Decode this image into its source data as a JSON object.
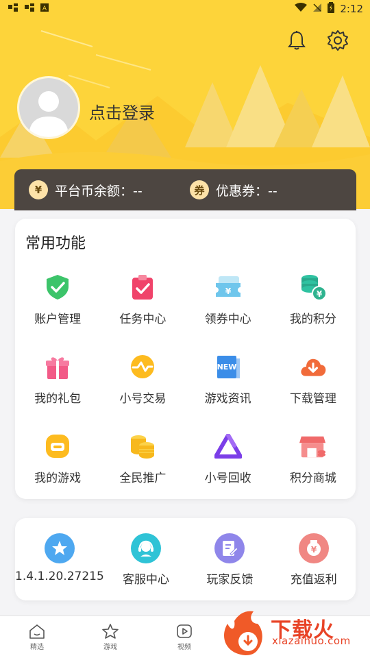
{
  "status_bar": {
    "time": "2:12"
  },
  "profile": {
    "login_text": "点击登录"
  },
  "balance": {
    "coin_icon": "¥",
    "coin_label": "平台币余额：--",
    "coupon_icon": "券",
    "coupon_label": "优惠券：--"
  },
  "common": {
    "title": "常用功能",
    "items": [
      {
        "label": "账户管理",
        "icon": "shield-check-icon"
      },
      {
        "label": "任务中心",
        "icon": "clipboard-check-icon"
      },
      {
        "label": "领券中心",
        "icon": "coupon-ticket-icon"
      },
      {
        "label": "我的积分",
        "icon": "coin-stack-icon"
      },
      {
        "label": "我的礼包",
        "icon": "gift-icon"
      },
      {
        "label": "小号交易",
        "icon": "trade-wave-icon"
      },
      {
        "label": "游戏资讯",
        "icon": "news-icon"
      },
      {
        "label": "下载管理",
        "icon": "cloud-download-icon"
      },
      {
        "label": "我的游戏",
        "icon": "gamepad-icon"
      },
      {
        "label": "全民推广",
        "icon": "coins-icon"
      },
      {
        "label": "小号回收",
        "icon": "recycle-icon"
      },
      {
        "label": "积分商城",
        "icon": "shop-icon"
      }
    ]
  },
  "secondary": {
    "items": [
      {
        "label": "1.4.1.20.27215",
        "icon": "star-icon",
        "color": "#4ea8f0"
      },
      {
        "label": "客服中心",
        "icon": "headset-icon",
        "color": "#2fc3d6"
      },
      {
        "label": "玩家反馈",
        "icon": "feedback-icon",
        "color": "#8f86ea"
      },
      {
        "label": "充值返利",
        "icon": "rebate-icon",
        "color": "#f08783"
      }
    ]
  },
  "bottom_nav": {
    "items": [
      {
        "label": "精选"
      },
      {
        "label": "游戏"
      },
      {
        "label": "视频"
      }
    ]
  },
  "watermark": {
    "title": "下载火",
    "url": "xiazaihuo.com"
  }
}
